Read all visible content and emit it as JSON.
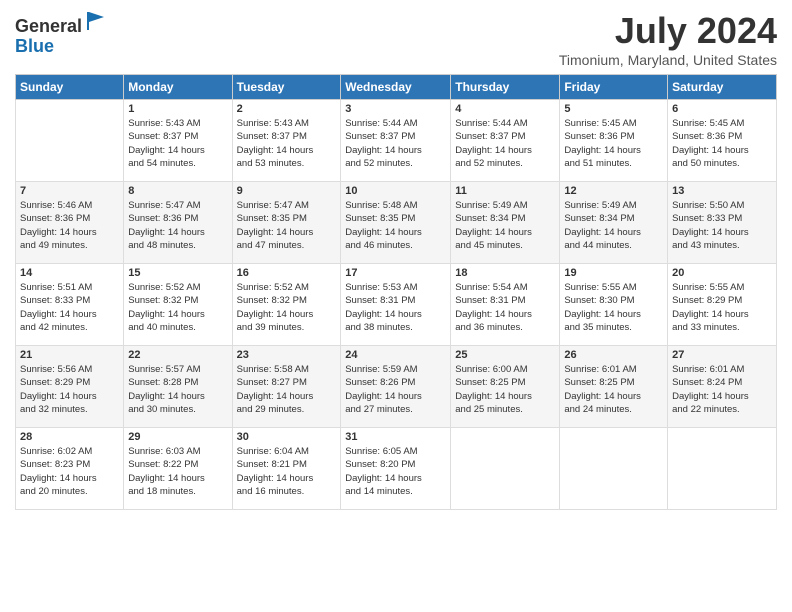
{
  "logo": {
    "general": "General",
    "blue": "Blue"
  },
  "title": "July 2024",
  "subtitle": "Timonium, Maryland, United States",
  "days_header": [
    "Sunday",
    "Monday",
    "Tuesday",
    "Wednesday",
    "Thursday",
    "Friday",
    "Saturday"
  ],
  "weeks": [
    [
      {
        "day": "",
        "info": ""
      },
      {
        "day": "1",
        "info": "Sunrise: 5:43 AM\nSunset: 8:37 PM\nDaylight: 14 hours\nand 54 minutes."
      },
      {
        "day": "2",
        "info": "Sunrise: 5:43 AM\nSunset: 8:37 PM\nDaylight: 14 hours\nand 53 minutes."
      },
      {
        "day": "3",
        "info": "Sunrise: 5:44 AM\nSunset: 8:37 PM\nDaylight: 14 hours\nand 52 minutes."
      },
      {
        "day": "4",
        "info": "Sunrise: 5:44 AM\nSunset: 8:37 PM\nDaylight: 14 hours\nand 52 minutes."
      },
      {
        "day": "5",
        "info": "Sunrise: 5:45 AM\nSunset: 8:36 PM\nDaylight: 14 hours\nand 51 minutes."
      },
      {
        "day": "6",
        "info": "Sunrise: 5:45 AM\nSunset: 8:36 PM\nDaylight: 14 hours\nand 50 minutes."
      }
    ],
    [
      {
        "day": "7",
        "info": "Sunrise: 5:46 AM\nSunset: 8:36 PM\nDaylight: 14 hours\nand 49 minutes."
      },
      {
        "day": "8",
        "info": "Sunrise: 5:47 AM\nSunset: 8:36 PM\nDaylight: 14 hours\nand 48 minutes."
      },
      {
        "day": "9",
        "info": "Sunrise: 5:47 AM\nSunset: 8:35 PM\nDaylight: 14 hours\nand 47 minutes."
      },
      {
        "day": "10",
        "info": "Sunrise: 5:48 AM\nSunset: 8:35 PM\nDaylight: 14 hours\nand 46 minutes."
      },
      {
        "day": "11",
        "info": "Sunrise: 5:49 AM\nSunset: 8:34 PM\nDaylight: 14 hours\nand 45 minutes."
      },
      {
        "day": "12",
        "info": "Sunrise: 5:49 AM\nSunset: 8:34 PM\nDaylight: 14 hours\nand 44 minutes."
      },
      {
        "day": "13",
        "info": "Sunrise: 5:50 AM\nSunset: 8:33 PM\nDaylight: 14 hours\nand 43 minutes."
      }
    ],
    [
      {
        "day": "14",
        "info": "Sunrise: 5:51 AM\nSunset: 8:33 PM\nDaylight: 14 hours\nand 42 minutes."
      },
      {
        "day": "15",
        "info": "Sunrise: 5:52 AM\nSunset: 8:32 PM\nDaylight: 14 hours\nand 40 minutes."
      },
      {
        "day": "16",
        "info": "Sunrise: 5:52 AM\nSunset: 8:32 PM\nDaylight: 14 hours\nand 39 minutes."
      },
      {
        "day": "17",
        "info": "Sunrise: 5:53 AM\nSunset: 8:31 PM\nDaylight: 14 hours\nand 38 minutes."
      },
      {
        "day": "18",
        "info": "Sunrise: 5:54 AM\nSunset: 8:31 PM\nDaylight: 14 hours\nand 36 minutes."
      },
      {
        "day": "19",
        "info": "Sunrise: 5:55 AM\nSunset: 8:30 PM\nDaylight: 14 hours\nand 35 minutes."
      },
      {
        "day": "20",
        "info": "Sunrise: 5:55 AM\nSunset: 8:29 PM\nDaylight: 14 hours\nand 33 minutes."
      }
    ],
    [
      {
        "day": "21",
        "info": "Sunrise: 5:56 AM\nSunset: 8:29 PM\nDaylight: 14 hours\nand 32 minutes."
      },
      {
        "day": "22",
        "info": "Sunrise: 5:57 AM\nSunset: 8:28 PM\nDaylight: 14 hours\nand 30 minutes."
      },
      {
        "day": "23",
        "info": "Sunrise: 5:58 AM\nSunset: 8:27 PM\nDaylight: 14 hours\nand 29 minutes."
      },
      {
        "day": "24",
        "info": "Sunrise: 5:59 AM\nSunset: 8:26 PM\nDaylight: 14 hours\nand 27 minutes."
      },
      {
        "day": "25",
        "info": "Sunrise: 6:00 AM\nSunset: 8:25 PM\nDaylight: 14 hours\nand 25 minutes."
      },
      {
        "day": "26",
        "info": "Sunrise: 6:01 AM\nSunset: 8:25 PM\nDaylight: 14 hours\nand 24 minutes."
      },
      {
        "day": "27",
        "info": "Sunrise: 6:01 AM\nSunset: 8:24 PM\nDaylight: 14 hours\nand 22 minutes."
      }
    ],
    [
      {
        "day": "28",
        "info": "Sunrise: 6:02 AM\nSunset: 8:23 PM\nDaylight: 14 hours\nand 20 minutes."
      },
      {
        "day": "29",
        "info": "Sunrise: 6:03 AM\nSunset: 8:22 PM\nDaylight: 14 hours\nand 18 minutes."
      },
      {
        "day": "30",
        "info": "Sunrise: 6:04 AM\nSunset: 8:21 PM\nDaylight: 14 hours\nand 16 minutes."
      },
      {
        "day": "31",
        "info": "Sunrise: 6:05 AM\nSunset: 8:20 PM\nDaylight: 14 hours\nand 14 minutes."
      },
      {
        "day": "",
        "info": ""
      },
      {
        "day": "",
        "info": ""
      },
      {
        "day": "",
        "info": ""
      }
    ]
  ]
}
